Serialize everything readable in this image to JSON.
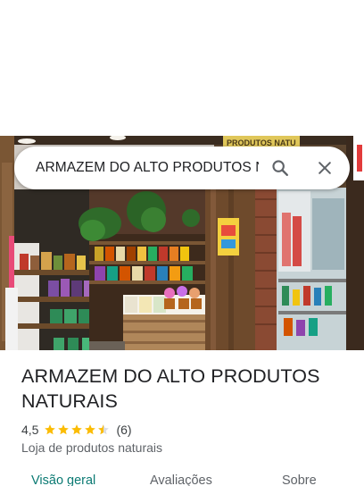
{
  "search": {
    "query": "ARMAZEM DO ALTO PRODUTOS NA",
    "search_icon": "search-icon",
    "close_icon": "close-icon"
  },
  "hero": {
    "image": "storefront-photo",
    "sign_text": "PRODUTOS NATU"
  },
  "place": {
    "title": "ARMAZEM DO ALTO PRODUTOS NATURAIS",
    "rating": "4,5",
    "rating_value": 4.5,
    "review_count": "(6)",
    "category": "Loja de produtos naturais"
  },
  "tabs": [
    {
      "label": "Visão geral",
      "active": true
    },
    {
      "label": "Avaliações",
      "active": false
    },
    {
      "label": "Sobre",
      "active": false
    }
  ],
  "colors": {
    "star": "#fbbc04",
    "active_tab": "#0b7a73",
    "title": "#202124",
    "secondary": "#5f6368"
  }
}
